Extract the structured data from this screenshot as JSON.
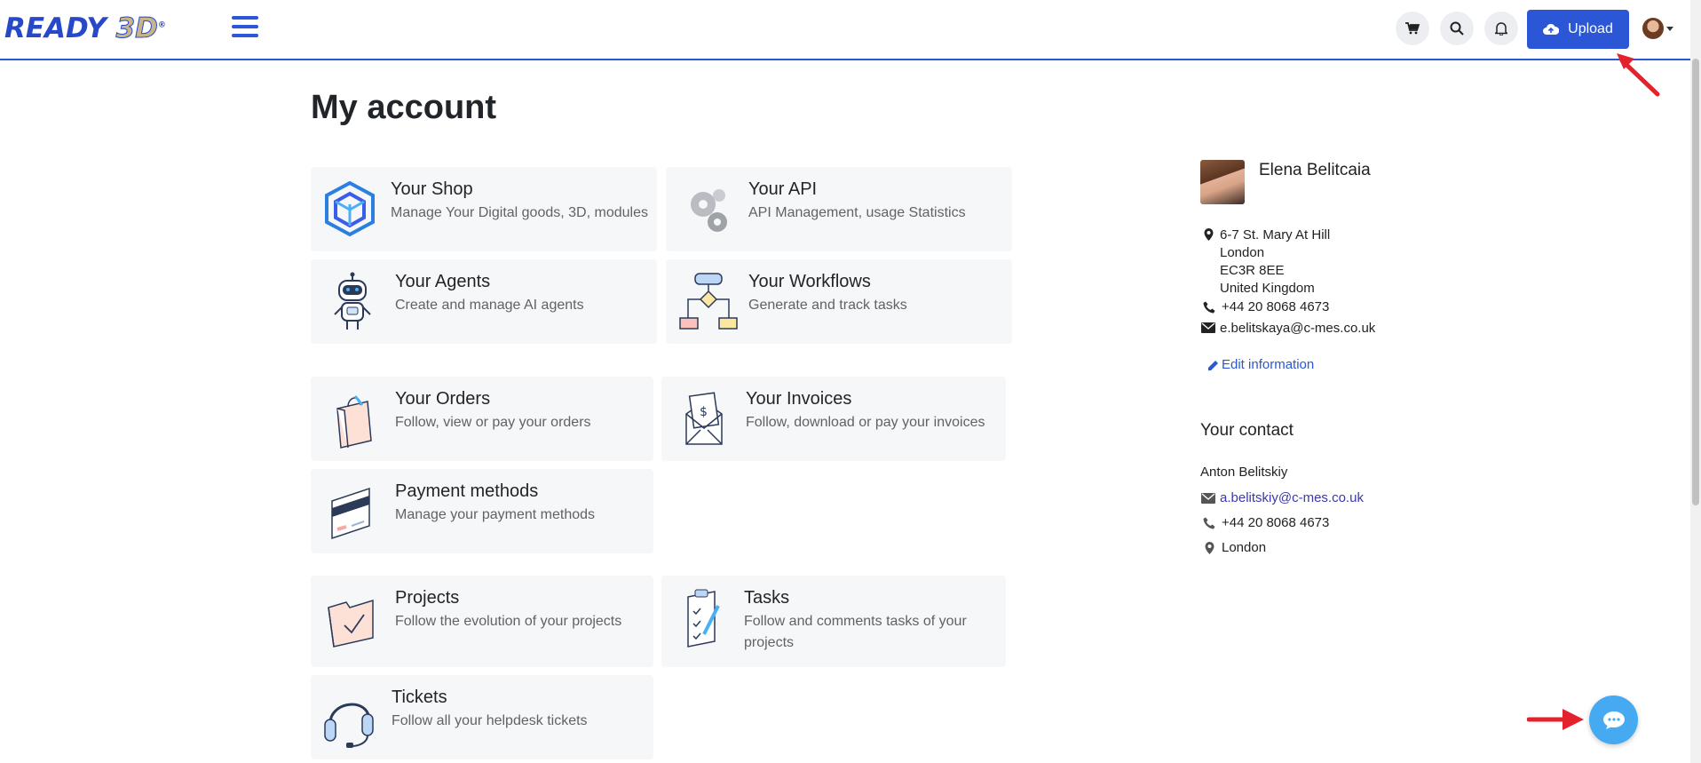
{
  "brand": {
    "logo_text_a": "READY",
    "logo_text_b": "3D",
    "logo_mark": "®"
  },
  "nav": {
    "upload_label": "Upload",
    "icons": [
      "cart-icon",
      "search-icon",
      "bell-icon",
      "upload-cloud-icon"
    ]
  },
  "page": {
    "title": "My account"
  },
  "cards": [
    {
      "title": "Your Shop",
      "desc": "Manage Your Digital goods, 3D, modules",
      "icon": "shop-cube-icon"
    },
    {
      "title": "Your API",
      "desc": "API Management, usage Statistics",
      "icon": "gears-icon"
    },
    {
      "title": "Your Agents",
      "desc": "Create and manage AI agents",
      "icon": "robot-icon"
    },
    {
      "title": "Your Workflows",
      "desc": "Generate and track tasks",
      "icon": "flowchart-icon"
    },
    {
      "title": "Your Orders",
      "desc": "Follow, view or pay your orders",
      "icon": "shopping-bag-icon"
    },
    {
      "title": "Your Invoices",
      "desc": "Follow, download or pay your invoices",
      "icon": "invoice-envelope-icon"
    },
    {
      "title": "Payment methods",
      "desc": "Manage your payment methods",
      "icon": "credit-card-icon"
    },
    {
      "title": "Projects",
      "desc": "Follow the evolution of your projects",
      "icon": "folder-icon"
    },
    {
      "title": "Tasks",
      "desc": "Follow and comments tasks of your projects",
      "icon": "clipboard-icon"
    },
    {
      "title": "Tickets",
      "desc": "Follow all your helpdesk tickets",
      "icon": "headset-icon"
    }
  ],
  "profile": {
    "name": "Elena Belitcaia",
    "address": [
      "6-7 St. Mary At Hill",
      "London",
      "EC3R 8EE",
      "United Kingdom"
    ],
    "phone": "+44 20 8068 4673",
    "email": "e.belitskaya@c-mes.co.uk",
    "edit_label": "Edit information"
  },
  "contact": {
    "heading": "Your contact",
    "name": "Anton Belitskiy",
    "email": "a.belitskiy@c-mes.co.uk",
    "phone": "+44 20 8068 4673",
    "city": "London"
  },
  "colors": {
    "primary": "#2b57d6",
    "card_bg": "#f6f7f9",
    "chat": "#45aaf2",
    "annotation_arrow": "#e3222c"
  }
}
